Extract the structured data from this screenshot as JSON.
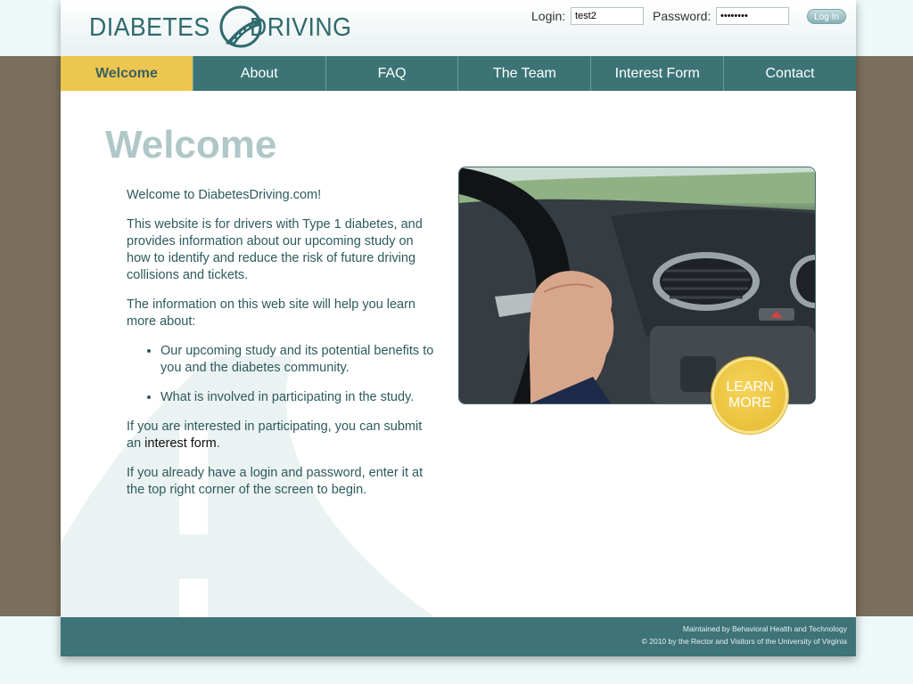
{
  "header": {
    "logo": {
      "word_left": "DIABETES",
      "word_right": "DRIVING"
    },
    "login": {
      "login_label": "Login:",
      "login_value": "test2",
      "password_label": "Password:",
      "password_value": "••••••••",
      "button_label": "Log In"
    }
  },
  "nav": {
    "items": [
      {
        "label": "Welcome",
        "active": true
      },
      {
        "label": "About"
      },
      {
        "label": "FAQ"
      },
      {
        "label": "The Team"
      },
      {
        "label": "Interest Form"
      },
      {
        "label": "Contact"
      }
    ]
  },
  "main": {
    "heading": "Welcome",
    "intro": "Welcome to DiabetesDriving.com!",
    "para1": "This website is for drivers with Type 1 diabetes, and provides information about our upcoming study on how to identify and reduce the risk of future driving collisions and tickets.",
    "para2": "The information on this web site will help you learn more about:",
    "bullets": [
      "Our upcoming study and its potential benefits to you and the diabetes community.",
      "What is involved in participating in the study."
    ],
    "para3_prefix": "If you are interested in participating, you can submit an ",
    "para3_link": "interest form",
    "para3_suffix": ".",
    "para4": "If you already have a login and password, enter it at the top right corner of the screen to begin."
  },
  "learn_more": {
    "line1": "LEARN",
    "line2": "MORE"
  },
  "footer": {
    "line1": "Maintained by Behavioral Health and Technology",
    "line2": "© 2010 by the Rector and Visitors of the University of Virginia"
  },
  "colors": {
    "accent_teal": "#3c7476",
    "active_tab": "#ecc64e",
    "heading_gray": "#b0c7c8",
    "text_teal": "#2d5a5c"
  }
}
